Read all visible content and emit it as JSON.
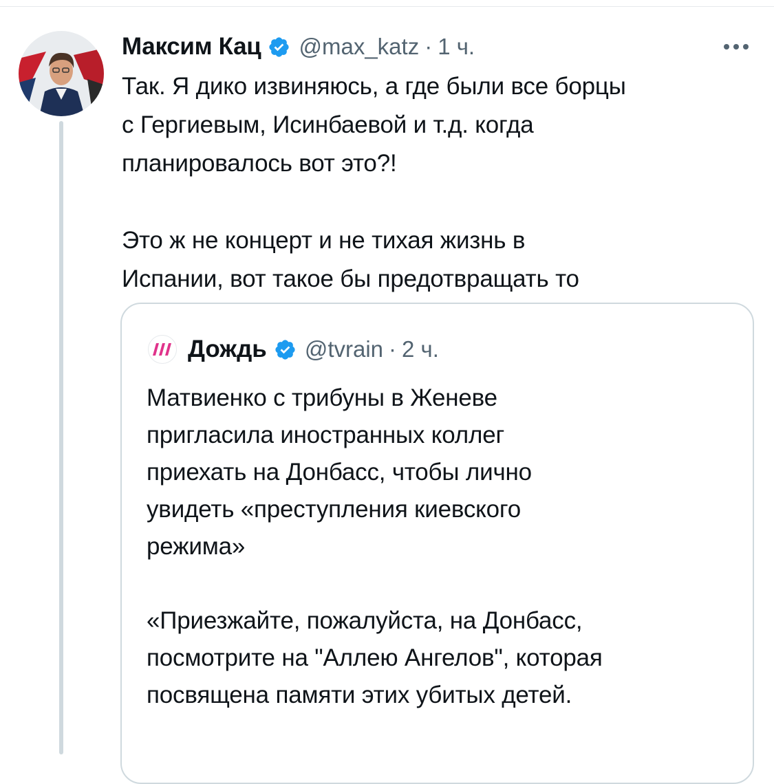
{
  "tweet": {
    "author_name": "Максим Кац",
    "handle": "@max_katz",
    "separator": "·",
    "time": "1 ч.",
    "text": "Так. Я дико извиняюсь, а где были все борцы\nс Гергиевым, Исинбаевой и т.д. когда\nпланировалось вот это?!\n\nЭто ж не концерт и не тихая жизнь в\nИспании, вот такое бы предотвращать то",
    "more_icon": "more-horizontal-icon",
    "verified_icon": "verified-badge-icon"
  },
  "quoted_tweet": {
    "author_name": "Дождь",
    "handle": "@tvrain",
    "separator": "·",
    "time": "2 ч.",
    "text": "Матвиенко с трибуны в Женеве\nпригласила иностранных коллег\nприехать на Донбасс, чтобы лично\nувидеть «преступления киевского\nрежима»\n\n«Приезжайте, пожалуйста, на Донбасс,\nпосмотрите на \"Аллею Ангелов\", которая\nпосвящена памяти этих убитых детей.",
    "logo_icon": "tvrain-logo-icon",
    "verified_icon": "verified-badge-icon"
  },
  "colors": {
    "verified_blue": "#1d9bf0",
    "secondary_text": "#536471",
    "border": "#cfd9de",
    "tvrain_pink": "#e0338b"
  }
}
